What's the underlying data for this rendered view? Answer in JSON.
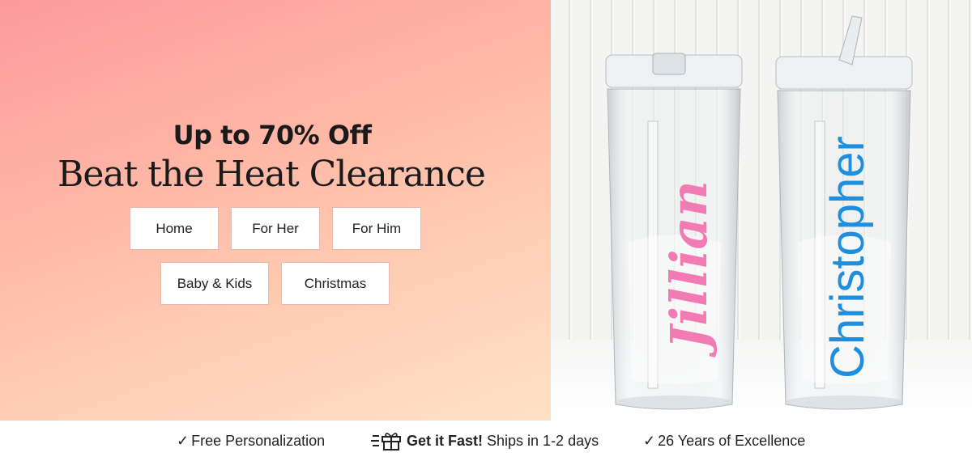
{
  "promo": {
    "headline": "Up to 70% Off",
    "title": "Beat the Heat Clearance"
  },
  "categories": {
    "row1": [
      {
        "label": "Home",
        "icon": ""
      },
      {
        "label": "For Her",
        "icon": ""
      },
      {
        "label": "For Him",
        "icon": ""
      }
    ],
    "row2": [
      {
        "label": "Baby & Kids",
        "icon": ""
      },
      {
        "label": "Christmas",
        "icon": ""
      }
    ]
  },
  "product_image": {
    "tumbler_left_name": "Jillian",
    "tumbler_right_name": "Christopher",
    "colors": {
      "left_name": "#f27bb4",
      "right_name": "#1e8fe0"
    }
  },
  "features": {
    "personalization": {
      "check_icon": "✓",
      "text": "Free Personalization"
    },
    "shipping": {
      "icon": "gift-icon",
      "bold": "Get it Fast!",
      "text": "Ships in 1-2 days"
    },
    "excellence": {
      "check_icon": "✓",
      "text": "26 Years of Excellence"
    }
  },
  "colors": {
    "gradient_start": "#fc9a9c",
    "gradient_end": "#ffe1c6",
    "button_border": "#e8b9b1"
  }
}
